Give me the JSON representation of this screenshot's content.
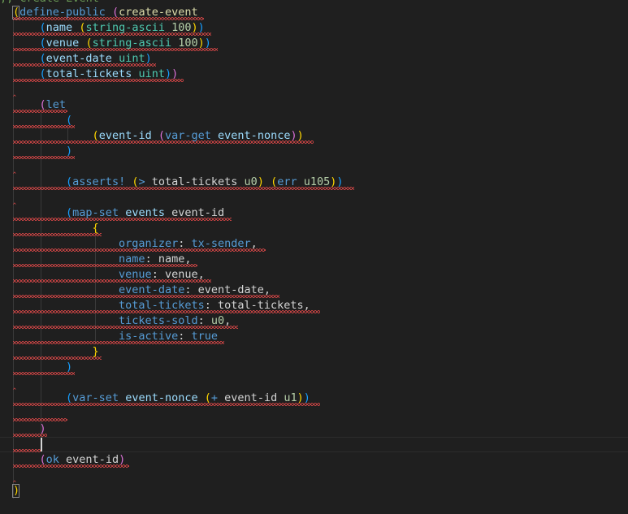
{
  "editor": {
    "language": "clarity",
    "comment_partial": ";; Create Event",
    "lines": [
      [
        {
          "t": "(",
          "c": "#ffd700"
        },
        {
          "t": "define-public",
          "c": "#569cd6"
        },
        {
          "t": " ",
          "c": "#d4d4d4"
        },
        {
          "t": "(",
          "c": "#da70d6"
        },
        {
          "t": "create-event",
          "c": "#dcdcaa"
        }
      ],
      [
        {
          "t": "    ",
          "c": "#d4d4d4"
        },
        {
          "t": "(",
          "c": "#179fff"
        },
        {
          "t": "name",
          "c": "#9cdcfe"
        },
        {
          "t": " ",
          "c": "#d4d4d4"
        },
        {
          "t": "(",
          "c": "#ffd700"
        },
        {
          "t": "string-ascii",
          "c": "#4ec9b0"
        },
        {
          "t": " ",
          "c": "#d4d4d4"
        },
        {
          "t": "100",
          "c": "#b5cea8"
        },
        {
          "t": ")",
          "c": "#ffd700"
        },
        {
          "t": ")",
          "c": "#179fff"
        }
      ],
      [
        {
          "t": "    ",
          "c": "#d4d4d4"
        },
        {
          "t": "(",
          "c": "#179fff"
        },
        {
          "t": "venue",
          "c": "#9cdcfe"
        },
        {
          "t": " ",
          "c": "#d4d4d4"
        },
        {
          "t": "(",
          "c": "#ffd700"
        },
        {
          "t": "string-ascii",
          "c": "#4ec9b0"
        },
        {
          "t": " ",
          "c": "#d4d4d4"
        },
        {
          "t": "100",
          "c": "#b5cea8"
        },
        {
          "t": ")",
          "c": "#ffd700"
        },
        {
          "t": ")",
          "c": "#179fff"
        }
      ],
      [
        {
          "t": "    ",
          "c": "#d4d4d4"
        },
        {
          "t": "(",
          "c": "#179fff"
        },
        {
          "t": "event-date",
          "c": "#9cdcfe"
        },
        {
          "t": " ",
          "c": "#d4d4d4"
        },
        {
          "t": "uint",
          "c": "#4ec9b0"
        },
        {
          "t": ")",
          "c": "#179fff"
        }
      ],
      [
        {
          "t": "    ",
          "c": "#d4d4d4"
        },
        {
          "t": "(",
          "c": "#179fff"
        },
        {
          "t": "total-tickets",
          "c": "#9cdcfe"
        },
        {
          "t": " ",
          "c": "#d4d4d4"
        },
        {
          "t": "uint",
          "c": "#4ec9b0"
        },
        {
          "t": ")",
          "c": "#179fff"
        },
        {
          "t": ")",
          "c": "#da70d6"
        }
      ],
      [],
      [
        {
          "t": "    ",
          "c": "#d4d4d4"
        },
        {
          "t": "(",
          "c": "#da70d6"
        },
        {
          "t": "let",
          "c": "#569cd6"
        }
      ],
      [
        {
          "t": "        ",
          "c": "#d4d4d4"
        },
        {
          "t": "(",
          "c": "#179fff"
        }
      ],
      [
        {
          "t": "            ",
          "c": "#d4d4d4"
        },
        {
          "t": "(",
          "c": "#ffd700"
        },
        {
          "t": "event-id",
          "c": "#9cdcfe"
        },
        {
          "t": " ",
          "c": "#d4d4d4"
        },
        {
          "t": "(",
          "c": "#da70d6"
        },
        {
          "t": "var-get",
          "c": "#569cd6"
        },
        {
          "t": " ",
          "c": "#d4d4d4"
        },
        {
          "t": "event-nonce",
          "c": "#9cdcfe"
        },
        {
          "t": ")",
          "c": "#da70d6"
        },
        {
          "t": ")",
          "c": "#ffd700"
        }
      ],
      [
        {
          "t": "        ",
          "c": "#d4d4d4"
        },
        {
          "t": ")",
          "c": "#179fff"
        }
      ],
      [],
      [
        {
          "t": "        ",
          "c": "#d4d4d4"
        },
        {
          "t": "(",
          "c": "#179fff"
        },
        {
          "t": "asserts!",
          "c": "#569cd6"
        },
        {
          "t": " ",
          "c": "#d4d4d4"
        },
        {
          "t": "(",
          "c": "#ffd700"
        },
        {
          "t": ">",
          "c": "#569cd6"
        },
        {
          "t": " total-tickets ",
          "c": "#d4d4d4"
        },
        {
          "t": "u0",
          "c": "#b5cea8"
        },
        {
          "t": ")",
          "c": "#ffd700"
        },
        {
          "t": " ",
          "c": "#d4d4d4"
        },
        {
          "t": "(",
          "c": "#ffd700"
        },
        {
          "t": "err",
          "c": "#569cd6"
        },
        {
          "t": " ",
          "c": "#d4d4d4"
        },
        {
          "t": "u105",
          "c": "#b5cea8"
        },
        {
          "t": ")",
          "c": "#ffd700"
        },
        {
          "t": ")",
          "c": "#179fff"
        }
      ],
      [],
      [
        {
          "t": "        ",
          "c": "#d4d4d4"
        },
        {
          "t": "(",
          "c": "#179fff"
        },
        {
          "t": "map-set",
          "c": "#569cd6"
        },
        {
          "t": " ",
          "c": "#d4d4d4"
        },
        {
          "t": "events",
          "c": "#9cdcfe"
        },
        {
          "t": " event-id",
          "c": "#d4d4d4"
        }
      ],
      [
        {
          "t": "            ",
          "c": "#d4d4d4"
        },
        {
          "t": "{",
          "c": "#ffd700"
        }
      ],
      [
        {
          "t": "                ",
          "c": "#d4d4d4"
        },
        {
          "t": "organizer",
          "c": "#569cd6"
        },
        {
          "t": ": ",
          "c": "#d4d4d4"
        },
        {
          "t": "tx-sender",
          "c": "#569cd6"
        },
        {
          "t": ",",
          "c": "#d4d4d4"
        }
      ],
      [
        {
          "t": "                ",
          "c": "#d4d4d4"
        },
        {
          "t": "name",
          "c": "#569cd6"
        },
        {
          "t": ": name,",
          "c": "#d4d4d4"
        }
      ],
      [
        {
          "t": "                ",
          "c": "#d4d4d4"
        },
        {
          "t": "venue",
          "c": "#569cd6"
        },
        {
          "t": ": venue,",
          "c": "#d4d4d4"
        }
      ],
      [
        {
          "t": "                ",
          "c": "#d4d4d4"
        },
        {
          "t": "event-date",
          "c": "#569cd6"
        },
        {
          "t": ": event-date,",
          "c": "#d4d4d4"
        }
      ],
      [
        {
          "t": "                ",
          "c": "#d4d4d4"
        },
        {
          "t": "total-tickets",
          "c": "#569cd6"
        },
        {
          "t": ": total-tickets,",
          "c": "#d4d4d4"
        }
      ],
      [
        {
          "t": "                ",
          "c": "#d4d4d4"
        },
        {
          "t": "tickets-sold",
          "c": "#569cd6"
        },
        {
          "t": ": ",
          "c": "#d4d4d4"
        },
        {
          "t": "u0",
          "c": "#b5cea8"
        },
        {
          "t": ",",
          "c": "#d4d4d4"
        }
      ],
      [
        {
          "t": "                ",
          "c": "#d4d4d4"
        },
        {
          "t": "is-active",
          "c": "#569cd6"
        },
        {
          "t": ": ",
          "c": "#d4d4d4"
        },
        {
          "t": "true",
          "c": "#569cd6"
        }
      ],
      [
        {
          "t": "            ",
          "c": "#d4d4d4"
        },
        {
          "t": "}",
          "c": "#ffd700"
        }
      ],
      [
        {
          "t": "        ",
          "c": "#d4d4d4"
        },
        {
          "t": ")",
          "c": "#179fff"
        }
      ],
      [],
      [
        {
          "t": "        ",
          "c": "#d4d4d4"
        },
        {
          "t": "(",
          "c": "#179fff"
        },
        {
          "t": "var-set",
          "c": "#569cd6"
        },
        {
          "t": " ",
          "c": "#d4d4d4"
        },
        {
          "t": "event-nonce",
          "c": "#9cdcfe"
        },
        {
          "t": " ",
          "c": "#d4d4d4"
        },
        {
          "t": "(",
          "c": "#ffd700"
        },
        {
          "t": "+",
          "c": "#569cd6"
        },
        {
          "t": " event-id ",
          "c": "#d4d4d4"
        },
        {
          "t": "u1",
          "c": "#b5cea8"
        },
        {
          "t": ")",
          "c": "#ffd700"
        },
        {
          "t": ")",
          "c": "#179fff"
        }
      ],
      [],
      [
        {
          "t": "    ",
          "c": "#d4d4d4"
        },
        {
          "t": ")",
          "c": "#da70d6"
        }
      ],
      [],
      [
        {
          "t": "    ",
          "c": "#d4d4d4"
        },
        {
          "t": "(",
          "c": "#da70d6"
        },
        {
          "t": "ok",
          "c": "#569cd6"
        },
        {
          "t": " event-id",
          "c": "#d4d4d4"
        },
        {
          "t": ")",
          "c": "#da70d6"
        }
      ],
      [],
      [
        {
          "t": ")",
          "c": "#ffd700"
        }
      ]
    ]
  }
}
